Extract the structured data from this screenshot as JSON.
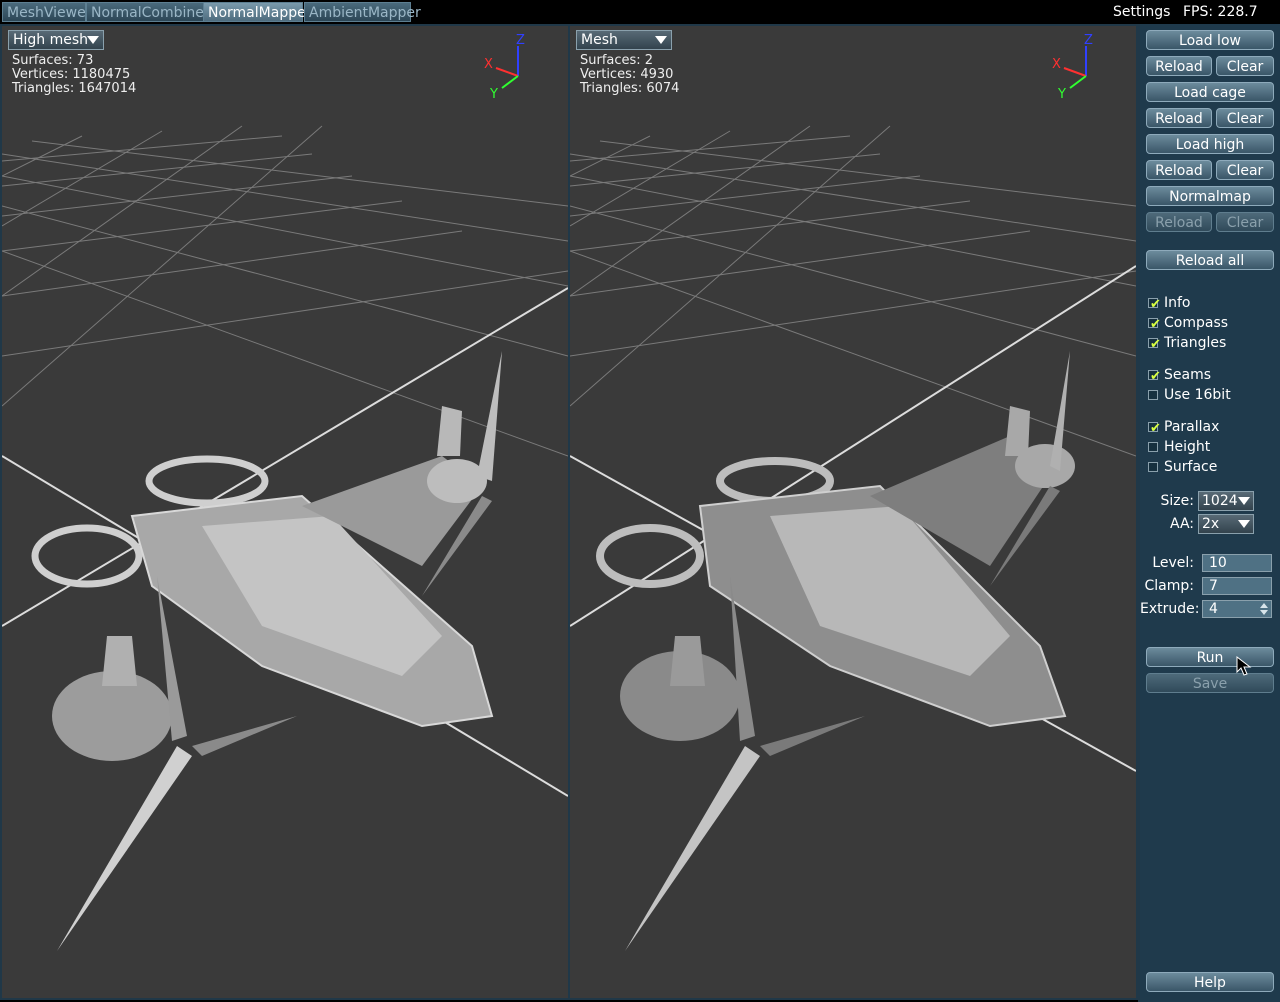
{
  "tabs": [
    {
      "label": "MeshViewer",
      "active": false
    },
    {
      "label": "NormalCombiner",
      "active": false
    },
    {
      "label": "NormalMapper",
      "active": true
    },
    {
      "label": "AmbientMapper",
      "active": false
    }
  ],
  "topbar": {
    "settings": "Settings",
    "fps": "FPS: 228.7"
  },
  "viewports": {
    "left": {
      "selector": "High mesh",
      "stats": [
        "Surfaces: 73",
        "Vertices: 1180475",
        "Triangles: 1647014"
      ]
    },
    "right": {
      "selector": "Mesh",
      "stats": [
        "Surfaces: 2",
        "Vertices: 4930",
        "Triangles: 6074"
      ]
    }
  },
  "compass": {
    "x": "X",
    "y": "Y",
    "z": "Z"
  },
  "panel": {
    "load_low": "Load low",
    "reload": "Reload",
    "clear": "Clear",
    "load_cage": "Load cage",
    "load_high": "Load high",
    "normalmap": "Normalmap",
    "reload_all": "Reload all",
    "checks": {
      "info": "Info",
      "compass": "Compass",
      "triangles": "Triangles",
      "seams": "Seams",
      "use16bit": "Use 16bit",
      "parallax": "Parallax",
      "height": "Height",
      "surface": "Surface"
    },
    "size_label": "Size:",
    "size_value": "1024",
    "aa_label": "AA:",
    "aa_value": "2x",
    "level_label": "Level:",
    "level_value": "10",
    "clamp_label": "Clamp:",
    "clamp_value": "7",
    "extrude_label": "Extrude:",
    "extrude_value": "4",
    "run": "Run",
    "save": "Save",
    "help": "Help"
  },
  "colors": {
    "panel_bg": "#1f3a4c",
    "viewport_bg": "#3a3a3a",
    "check_tick": "#d8ff40",
    "axis_x": "#ff3030",
    "axis_y": "#30ff30",
    "axis_z": "#3040ff"
  }
}
